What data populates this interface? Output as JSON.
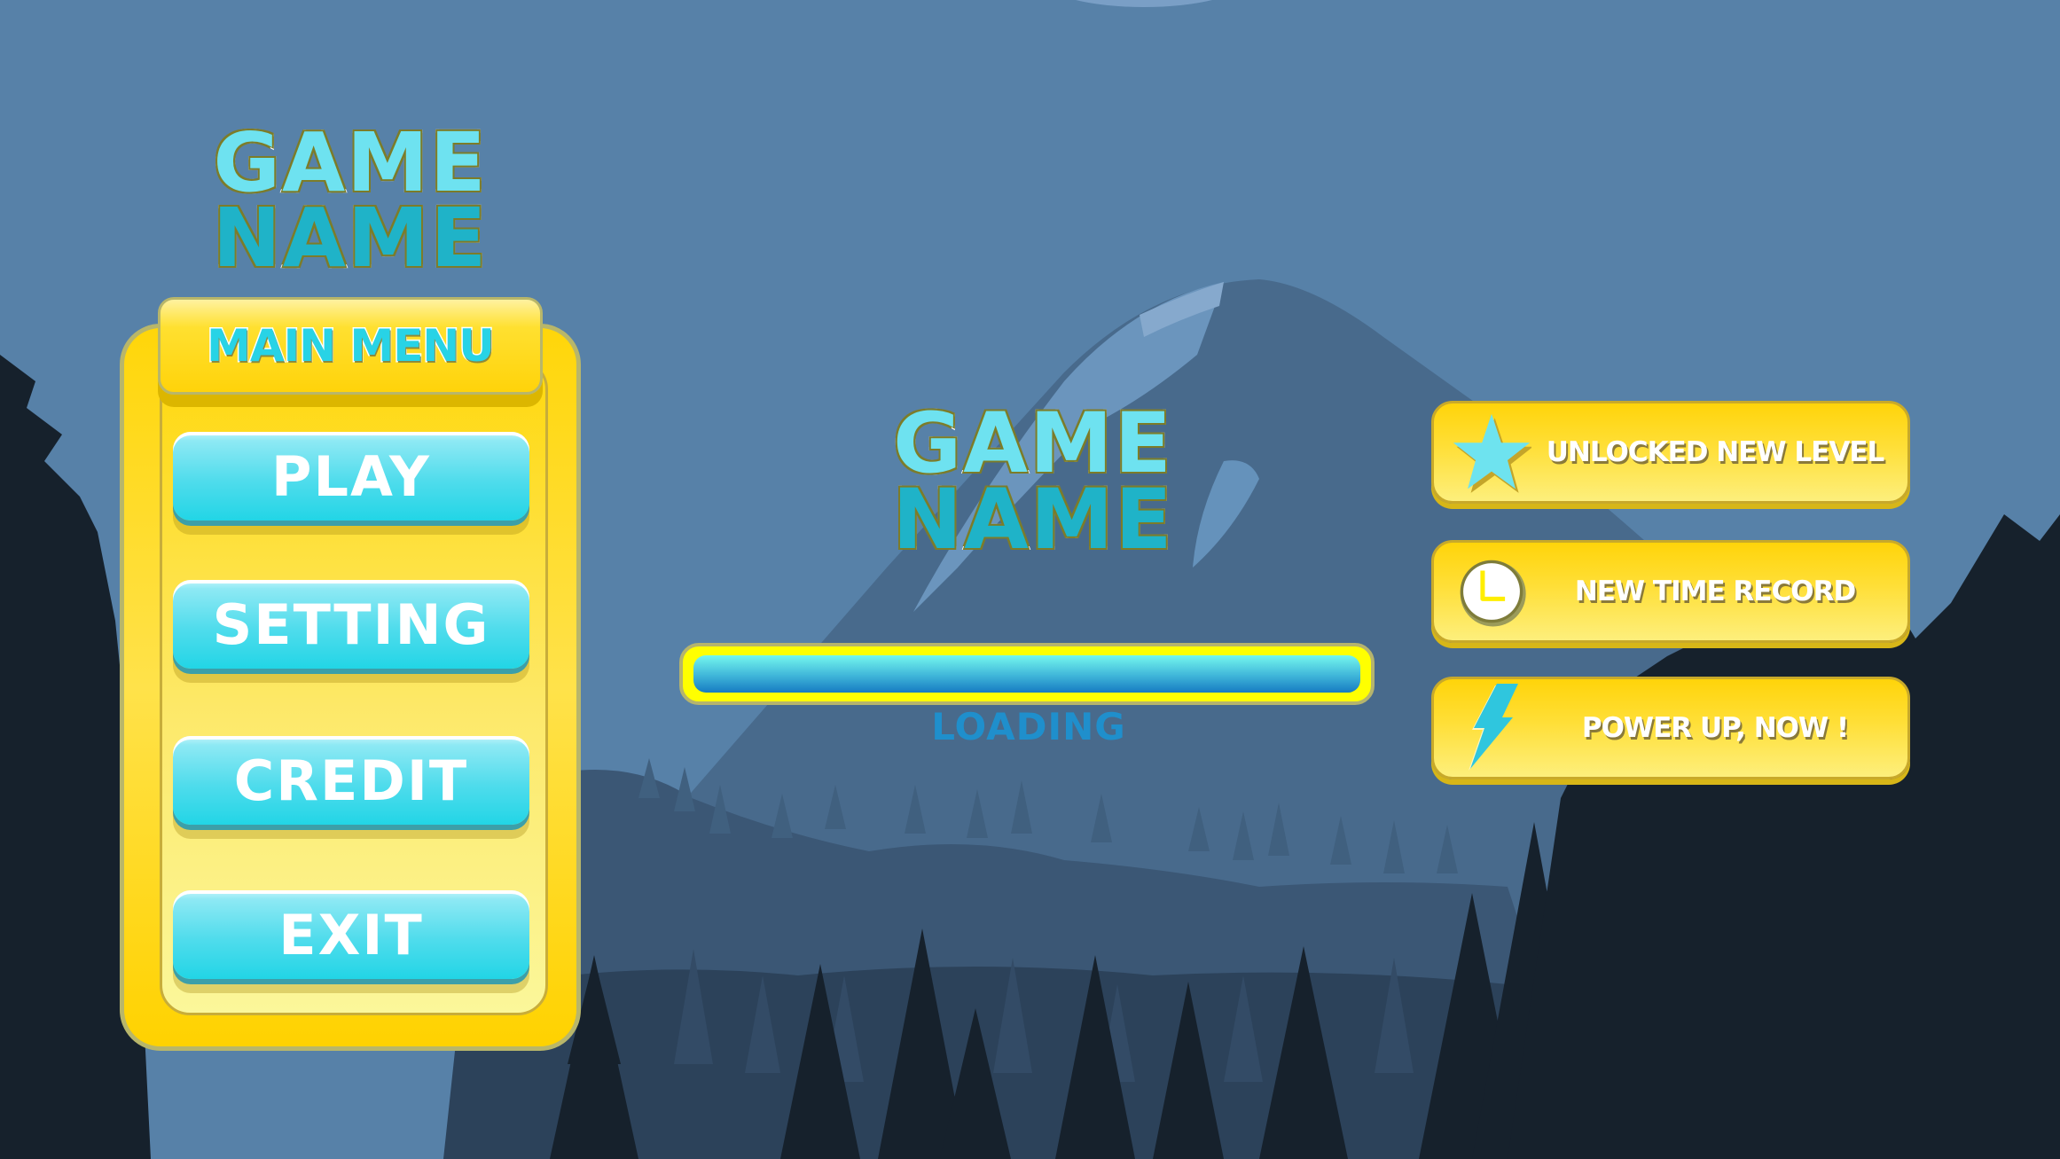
{
  "game": {
    "title_line1": "GAME",
    "title_line2": "NAME"
  },
  "main_menu": {
    "header": "MAIN MENU",
    "buttons": [
      {
        "label": "PLAY"
      },
      {
        "label": "SETTING"
      },
      {
        "label": "CREDIT"
      },
      {
        "label": "EXIT"
      }
    ]
  },
  "loading": {
    "label": "LOADING",
    "progress": 1.0
  },
  "notifications": [
    {
      "icon": "star-icon",
      "label": "UNLOCKED NEW LEVEL"
    },
    {
      "icon": "clock-icon",
      "label": "NEW TIME RECORD"
    },
    {
      "icon": "lightning-icon",
      "label": "POWER UP, NOW !"
    }
  ],
  "colors": {
    "sky": "#5781a8",
    "mountain": "#486a8c",
    "forest_dark": "#16212c",
    "panel_yellow": "#ffd60a",
    "button_cyan": "#22d5e6",
    "loading_border": "#ffff00",
    "loading_text": "#1f8fcc"
  }
}
